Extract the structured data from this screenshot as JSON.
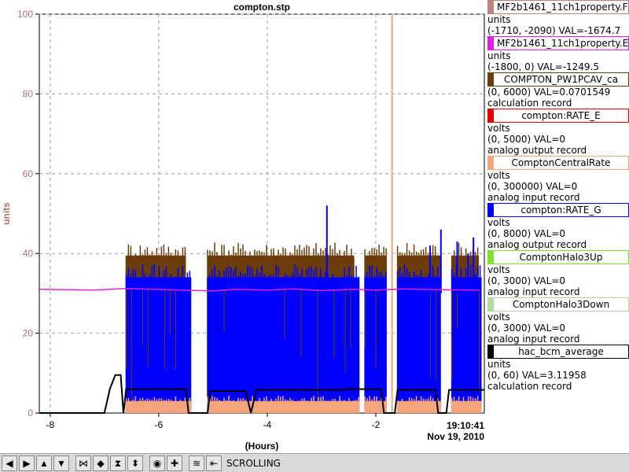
{
  "chart_data": {
    "type": "line",
    "title": "compton.stp",
    "xlabel": "(Hours)",
    "ylabel": "units",
    "xlim": [
      -8.2,
      0
    ],
    "ylim": [
      0,
      100
    ],
    "x_ticks": [
      -8,
      -6,
      -4,
      -2
    ],
    "x_tick_labels": [
      "-8",
      "-6",
      "-4",
      "-2"
    ],
    "y_ticks": [
      0,
      20,
      40,
      60,
      80,
      100
    ],
    "y_tick_labels": [
      "0",
      "20",
      "40",
      "60",
      "80",
      "100"
    ],
    "grid": true,
    "time_label": "19:10:41",
    "date_label": "Nov 19, 2010",
    "annotations": [
      {
        "label": "vertical marker (ComptonCentralRate)",
        "x": -1.7,
        "y_range": [
          0,
          100
        ]
      }
    ],
    "series": [
      {
        "name": "MF2b1461_11ch1property.E",
        "color": "#e020e0",
        "points": [
          [
            -8.2,
            31
          ],
          [
            -7.2,
            30.8
          ],
          [
            -6.6,
            31.2
          ],
          [
            -5.8,
            30.9
          ],
          [
            -5.0,
            30.6
          ],
          [
            -4.6,
            31.0
          ],
          [
            -4.0,
            30.8
          ],
          [
            -3.5,
            31.1
          ],
          [
            -3.0,
            30.7
          ],
          [
            -2.4,
            31.0
          ],
          [
            -2.0,
            30.8
          ],
          [
            -1.5,
            31.1
          ],
          [
            -0.8,
            30.9
          ],
          [
            -0.1,
            30.8
          ]
        ]
      },
      {
        "name": "COMPTON_PW1PCAV_ca",
        "color": "#6b3d0a",
        "bands": [
          [
            -6.6,
            -5.5
          ],
          [
            -5.1,
            -2.4
          ],
          [
            -2.2,
            -1.8
          ],
          [
            -1.6,
            -0.8
          ],
          [
            -0.6,
            -0.1
          ]
        ],
        "upper": 39.5,
        "lower": 30
      },
      {
        "name": "compton:RATE_G",
        "color": "#0000ff",
        "bands": [
          [
            -6.6,
            -5.4
          ],
          [
            -5.1,
            -2.3
          ],
          [
            -2.2,
            -1.8
          ],
          [
            -1.6,
            -0.8
          ],
          [
            -0.6,
            -0.05
          ]
        ],
        "upper": 34,
        "lower": 1,
        "spikes": [
          [
            -2.9,
            52
          ],
          [
            -0.8,
            46
          ],
          [
            -0.5,
            43
          ],
          [
            -0.3,
            40
          ],
          [
            -0.2,
            44
          ],
          [
            -1.0,
            42
          ]
        ]
      },
      {
        "name": "ComptonCentralRate",
        "color": "#f4a57c",
        "bands": [
          [
            -6.6,
            -5.4
          ],
          [
            -5.1,
            -2.3
          ],
          [
            -2.2,
            -1.8
          ],
          [
            -1.6,
            -0.8
          ],
          [
            -0.6,
            -0.05
          ]
        ],
        "upper": 3,
        "lower": 0
      },
      {
        "name": "hac_bcm_average",
        "color": "#000000",
        "points": [
          [
            -8.2,
            0
          ],
          [
            -7.0,
            0
          ],
          [
            -6.9,
            6
          ],
          [
            -6.8,
            9.5
          ],
          [
            -6.7,
            9.5
          ],
          [
            -6.65,
            0
          ],
          [
            -6.6,
            6
          ],
          [
            -5.5,
            6
          ],
          [
            -5.45,
            0
          ],
          [
            -5.1,
            0
          ],
          [
            -5.05,
            5.5
          ],
          [
            -4.4,
            5.5
          ],
          [
            -4.3,
            0
          ],
          [
            -4.2,
            5.8
          ],
          [
            -2.6,
            5.8
          ],
          [
            -2.5,
            6
          ],
          [
            -1.9,
            6
          ],
          [
            -1.85,
            0
          ],
          [
            -1.65,
            0
          ],
          [
            -1.6,
            5.8
          ],
          [
            -0.9,
            5.8
          ],
          [
            -0.85,
            0
          ],
          [
            -0.7,
            0
          ],
          [
            -0.65,
            5.8
          ],
          [
            0,
            5.8
          ]
        ]
      }
    ]
  },
  "legend": [
    {
      "name": "MF2b1461_11ch1property.F",
      "color": "#c08080",
      "lines": [
        "units",
        "(-1710, -2090) VAL=-1674.7"
      ]
    },
    {
      "name": "MF2b1461_11ch1property.E",
      "color": "#e020e0",
      "lines": [
        "units",
        "(-1800, 0) VAL=-1249.5"
      ]
    },
    {
      "name": "COMPTON_PW1PCAV_ca",
      "color": "#6b3d0a",
      "lines": [
        "(0, 6000) VAL=0.0701549",
        "calculation record"
      ]
    },
    {
      "name": "compton:RATE_E",
      "color": "#e00000",
      "lines": [
        "volts",
        "(0, 5000) VAL=0",
        "analog output record"
      ]
    },
    {
      "name": "ComptonCentralRate",
      "color": "#f4a57c",
      "lines": [
        "volts",
        "(0, 300000) VAL=0",
        "analog input record"
      ]
    },
    {
      "name": "compton:RATE_G",
      "color": "#0000ff",
      "lines": [
        "volts",
        "(0, 8000) VAL=0",
        "analog output record"
      ]
    },
    {
      "name": "ComptonHalo3Up",
      "color": "#80e030",
      "lines": [
        "volts",
        "(0, 3000) VAL=0",
        "analog input record"
      ]
    },
    {
      "name": "ComptonHalo3Down",
      "color": "#b0d8a0",
      "lines": [
        "volts",
        "(0, 3000) VAL=0",
        "analog input record"
      ]
    },
    {
      "name": "hac_bcm_average",
      "color": "#000000",
      "lines": [
        "units",
        "(0, 60) VAL=3.11958",
        "calculation record"
      ]
    }
  ],
  "toolbar": {
    "buttons": [
      {
        "name": "scroll-left-button",
        "icon": "arrow-left-icon",
        "glyph": "◀"
      },
      {
        "name": "scroll-right-button",
        "icon": "arrow-right-icon",
        "glyph": "▶"
      },
      {
        "name": "scroll-up-button",
        "icon": "arrow-up-icon",
        "glyph": "▲"
      },
      {
        "name": "scroll-down-button",
        "icon": "arrow-down-icon",
        "glyph": "▼"
      },
      {
        "name": "compress-horizontal-button",
        "icon": "compress-horizontal-icon",
        "glyph": "⋈"
      },
      {
        "name": "expand-horizontal-button",
        "icon": "expand-horizontal-icon",
        "glyph": "◆"
      },
      {
        "name": "compress-vertical-button",
        "icon": "compress-vertical-icon",
        "glyph": "⧗"
      },
      {
        "name": "expand-vertical-button",
        "icon": "expand-vertical-icon",
        "glyph": "⬍"
      },
      {
        "name": "zoom-button",
        "icon": "target-icon",
        "glyph": "◉"
      },
      {
        "name": "add-button",
        "icon": "plus-icon",
        "glyph": "✚"
      },
      {
        "name": "autoscale-button",
        "icon": "autoscale-icon",
        "glyph": "≋"
      },
      {
        "name": "scroll-mode-button",
        "icon": "scroll-mode-icon",
        "glyph": "⇤"
      }
    ],
    "mode_label": "SCROLLING"
  }
}
